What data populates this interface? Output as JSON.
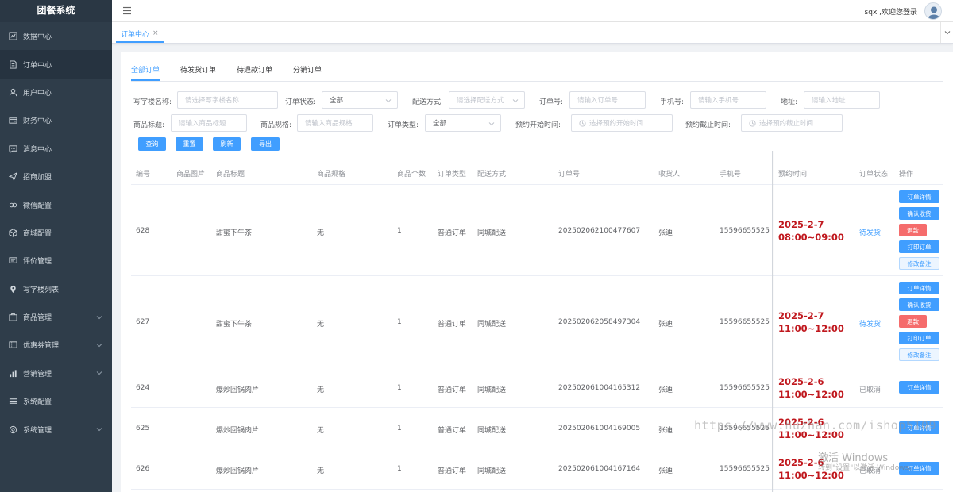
{
  "app": {
    "title": "团餐系统"
  },
  "sidebar": {
    "items": [
      {
        "label": "数据中心",
        "icon": "chart-icon"
      },
      {
        "label": "订单中心",
        "icon": "document-icon"
      },
      {
        "label": "用户中心",
        "icon": "user-icon"
      },
      {
        "label": "财务中心",
        "icon": "wallet-icon"
      },
      {
        "label": "消息中心",
        "icon": "message-icon"
      },
      {
        "label": "招商加盟",
        "icon": "send-icon"
      },
      {
        "label": "微信配置",
        "icon": "link-icon"
      },
      {
        "label": "商城配置",
        "icon": "box-icon"
      },
      {
        "label": "评价管理",
        "icon": "comment-icon"
      },
      {
        "label": "写字楼列表",
        "icon": "location-icon"
      },
      {
        "label": "商品管理",
        "icon": "goods-icon"
      },
      {
        "label": "优惠券管理",
        "icon": "coupon-icon"
      },
      {
        "label": "营销管理",
        "icon": "bar-chart-icon"
      },
      {
        "label": "系统配置",
        "icon": "list-icon"
      },
      {
        "label": "系统管理",
        "icon": "settings-icon"
      }
    ]
  },
  "header": {
    "user_text": "sqx ,欢迎您登录"
  },
  "tabbar": {
    "tab_label": "订单中心",
    "close": "×"
  },
  "subtabs": [
    "全部订单",
    "待发货订单",
    "待退款订单",
    "分销订单"
  ],
  "filters": {
    "building_label": "写字楼名称:",
    "building_ph": "请选择写字楼名称",
    "status_label": "订单状态:",
    "status_val": "全部",
    "delivery_label": "配送方式:",
    "delivery_ph": "请选择配送方式",
    "orderno_label": "订单号:",
    "orderno_ph": "请输入订单号",
    "phone_label": "手机号:",
    "phone_ph": "请输入手机号",
    "address_label": "地址:",
    "address_ph": "请输入地址",
    "title_label": "商品标题:",
    "title_ph": "请输入商品标题",
    "spec_label": "商品规格:",
    "spec_ph": "请输入商品规格",
    "type_label": "订单类型:",
    "type_val": "全部",
    "start_label": "预约开始时间:",
    "start_ph": "选择预约开始时间",
    "end_label": "预约截止时间:",
    "end_ph": "选择预约截止时间"
  },
  "buttons": {
    "query": "查询",
    "reset": "重置",
    "refresh": "刷新",
    "export": "导出"
  },
  "table": {
    "headers": [
      "编号",
      "商品图片",
      "商品标题",
      "商品规格",
      "商品个数",
      "订单类型",
      "配送方式",
      "订单号",
      "收货人",
      "手机号",
      "预约时间",
      "订单状态",
      "操作"
    ],
    "rows": [
      {
        "id": "628",
        "title": "甜蜜下午茶",
        "spec": "无",
        "count": "1",
        "otype": "普通订单",
        "delivery": "同城配送",
        "orderno": "202502062100477607",
        "receiver": "张迪",
        "phone": "15596655525",
        "time": "2025-2-7 08:00~09:00",
        "status": "待发货"
      },
      {
        "id": "627",
        "title": "甜蜜下午茶",
        "spec": "无",
        "count": "1",
        "otype": "普通订单",
        "delivery": "同城配送",
        "orderno": "202502062058497304",
        "receiver": "张迪",
        "phone": "15596655525",
        "time": "2025-2-7 11:00~12:00",
        "status": "待发货"
      },
      {
        "id": "624",
        "title": "爆炒回锅肉片",
        "spec": "无",
        "count": "1",
        "otype": "普通订单",
        "delivery": "同城配送",
        "orderno": "202502061004165312",
        "receiver": "张迪",
        "phone": "15596655525",
        "time": "2025-2-6 11:00~12:00",
        "status": "已取消"
      },
      {
        "id": "625",
        "title": "爆炒回锅肉片",
        "spec": "无",
        "count": "1",
        "otype": "普通订单",
        "delivery": "同城配送",
        "orderno": "202502061004169005",
        "receiver": "张迪",
        "phone": "15596655525",
        "time": "2025-2-6 11:00~12:00",
        "status": ""
      },
      {
        "id": "626",
        "title": "爆炒回锅肉片",
        "spec": "无",
        "count": "1",
        "otype": "普通订单",
        "delivery": "同城配送",
        "orderno": "202502061004167164",
        "receiver": "张迪",
        "phone": "15596655525",
        "time": "2025-2-6 11:00~12:00",
        "status": "已取消"
      }
    ],
    "actions": {
      "detail": "订单详情",
      "confirm": "确认收货",
      "refund": "退款",
      "print": "打印订单",
      "remark": "修改备注"
    }
  },
  "overlay": {
    "watermark": "https://www.huzhan.com/ishop5109",
    "activate_title": "激活 Windows",
    "activate_sub": "转到\"设置\"以激活 Windows。"
  },
  "colors": {
    "primary": "#409eff",
    "danger": "#f56c6c",
    "sidebar": "#2f3d4a",
    "time": "#c0181e"
  }
}
